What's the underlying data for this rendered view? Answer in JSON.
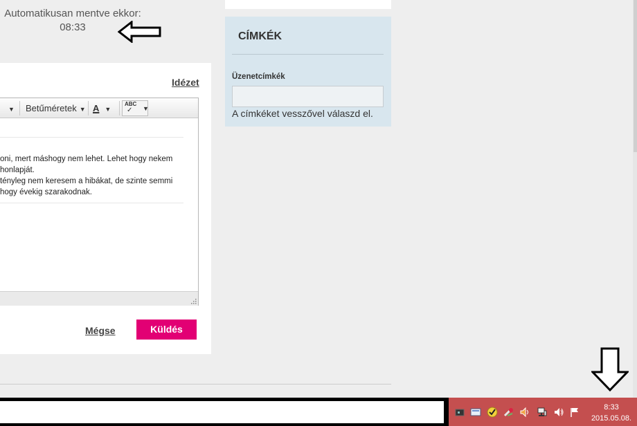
{
  "autosave": {
    "label": "Automatikusan mentve ekkor:",
    "time": "08:33"
  },
  "editor": {
    "quote_link": "Idézet",
    "toolbar": {
      "font_size": "Betűméretek",
      "text_color_letter": "A",
      "spellcheck_letters": "ABC"
    },
    "body_lines": [
      "oni, mert máshogy nem lehet. Lehet hogy nekem",
      " honlapját.",
      " tényleg nem keresem a hibákat, de szinte semmi",
      "hogy évekig szarakodnak."
    ]
  },
  "actions": {
    "cancel": "Mégse",
    "send": "Küldés"
  },
  "tags_panel": {
    "title": "CÍMKÉK",
    "field_label": "Üzenetcímkék",
    "field_value": "",
    "hint": "A címkéket vesszővel válaszd el."
  },
  "taskbar": {
    "clock_time": "8:33",
    "clock_date": "2015.05.08.",
    "tray_icons": [
      "battery-icon",
      "message-icon",
      "checkmark-shield-icon",
      "tools-icon",
      "volume-icon",
      "network-icon",
      "speaker-icon",
      "flag-icon"
    ]
  },
  "colors": {
    "accent": "#e20074",
    "tags_panel_bg": "#d8e6ee",
    "taskbar_tray": "#c44f4f"
  }
}
